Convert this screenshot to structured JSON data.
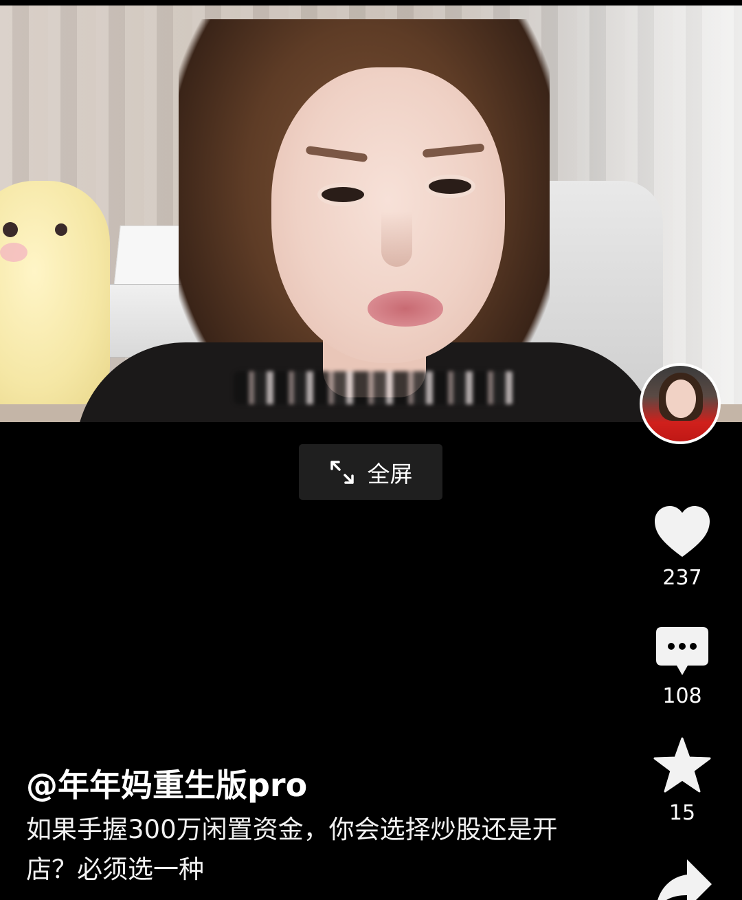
{
  "video": {
    "fullscreen_label": "全屏"
  },
  "actions": {
    "like_count": "237",
    "comment_count": "108",
    "favorite_count": "15"
  },
  "post": {
    "author": "@年年妈重生版pro",
    "description": "如果手握300万闲置资金，你会选择炒股还是开店？必须选一种"
  },
  "colors": {
    "background": "#000000",
    "button_bg": "#1f1f1f",
    "icon": "#f2f2f2"
  }
}
